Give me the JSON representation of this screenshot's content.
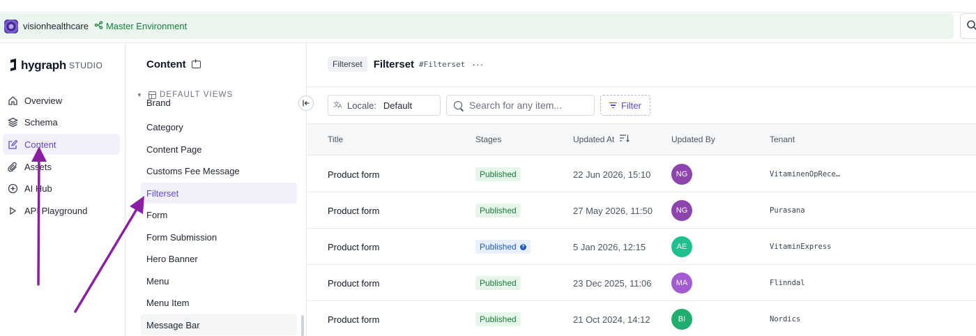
{
  "topbar": {
    "project_name": "visionhealthcare",
    "environment": "Master Environment"
  },
  "leftnav": {
    "brand": "hygraph",
    "brand_suffix": "STUDIO",
    "items": [
      {
        "label": "Overview",
        "icon": "home-icon"
      },
      {
        "label": "Schema",
        "icon": "layers-icon"
      },
      {
        "label": "Content",
        "icon": "edit-icon",
        "active": true
      },
      {
        "label": "Assets",
        "icon": "paperclip-icon"
      },
      {
        "label": "AI Hub",
        "icon": "sparkle-icon"
      },
      {
        "label": "API Playground",
        "icon": "play-icon"
      }
    ]
  },
  "content_panel": {
    "title": "Content",
    "views_heading": "DEFAULT VIEWS",
    "models": [
      "Brand",
      "Category",
      "Content Page",
      "Customs Fee Message",
      "Filterset",
      "Form",
      "Form Submission",
      "Hero Banner",
      "Menu",
      "Menu Item",
      "Message Bar"
    ],
    "active_model": "Filterset"
  },
  "main": {
    "model_chip": "Filterset",
    "model_name": "Filterset",
    "model_api_id": "#Filterset",
    "more": "···",
    "locale_label": "Locale:",
    "locale_value": "Default",
    "search_placeholder": "Search for any item...",
    "filter_label": "Filter",
    "columns": [
      "Title",
      "Stages",
      "Updated At",
      "Updated By",
      "Tenant"
    ],
    "rows": [
      {
        "title": "Product form",
        "stage": "Published",
        "stage_info": false,
        "updated_at": "22 Jun 2026, 15:10",
        "by": "NG",
        "by_color": "#8e44ad",
        "tenant": "VitaminenOpRece…"
      },
      {
        "title": "Product form",
        "stage": "Published",
        "stage_info": false,
        "updated_at": "27 May 2026, 11:50",
        "by": "NG",
        "by_color": "#8e44ad",
        "tenant": "Purasana"
      },
      {
        "title": "Product form",
        "stage": "Published",
        "stage_info": true,
        "updated_at": "5 Jan 2026, 12:15",
        "by": "AE",
        "by_color": "#1fbf8f",
        "tenant": "VitaminExpress"
      },
      {
        "title": "Product form",
        "stage": "Published",
        "stage_info": false,
        "updated_at": "23 Dec 2025, 11:06",
        "by": "MA",
        "by_color": "#a35bd1",
        "tenant": "Flinndal"
      },
      {
        "title": "Product form",
        "stage": "Published",
        "stage_info": false,
        "updated_at": "21 Oct 2024, 14:12",
        "by": "BI",
        "by_color": "#1fae6c",
        "tenant": "Nordics"
      }
    ]
  },
  "colors": {
    "accent": "#5b4bd6",
    "env_bg": "#ebf7ee",
    "env_text": "#15803d",
    "annotation_arrow": "#8b1fa3"
  }
}
